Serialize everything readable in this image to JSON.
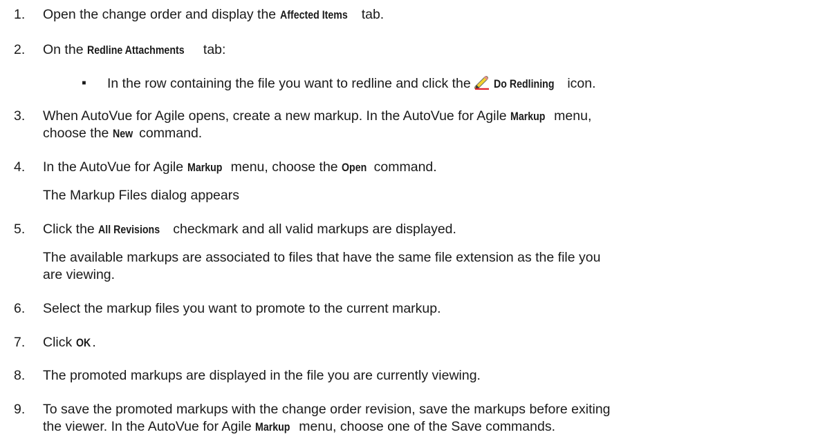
{
  "steps": [
    {
      "num": "1.",
      "a": "Open the change order and display the ",
      "b": "Affected Items",
      "c": " tab."
    },
    {
      "num": "2.",
      "a": "On the ",
      "b": "Redline Attachments",
      "c": " tab:"
    },
    {
      "bullet": "▪",
      "a": "In the row containing the file you want to redline and click the ",
      "b": "Do Redlining",
      "c": " icon.",
      "icon": "pencil-redline-icon"
    },
    {
      "num": "3.",
      "line1a": "When AutoVue for Agile opens, create a new markup. In the AutoVue for Agile ",
      "line1b": "Markup",
      "line1c": " menu,",
      "line2a": "choose the ",
      "line2b": "New",
      "line2c": " command."
    },
    {
      "num": "4.",
      "a": "In the AutoVue for Agile ",
      "b": "Markup",
      "c": " menu, choose the ",
      "d": "Open",
      "e": " command.",
      "note": "The Markup Files dialog appears"
    },
    {
      "num": "5.",
      "a": "Click the ",
      "b": "All Revisions",
      "c": " checkmark and all valid markups are displayed.",
      "note1": "The available markups are associated to files that have the same file extension as the file you",
      "note2": "are viewing."
    },
    {
      "num": "6.",
      "a": "Select the markup files you want to promote to the current markup."
    },
    {
      "num": "7.",
      "a": "Click ",
      "b": "OK",
      "c": "."
    },
    {
      "num": "8.",
      "a": "The promoted markups are displayed in the file you are currently viewing."
    },
    {
      "num": "9.",
      "line1": "To save the promoted markups with the change order revision, save the markups before exiting",
      "line2a": "the viewer. In the AutoVue for Agile ",
      "line2b": "Markup",
      "line2c": " menu, choose one of the Save commands."
    }
  ]
}
